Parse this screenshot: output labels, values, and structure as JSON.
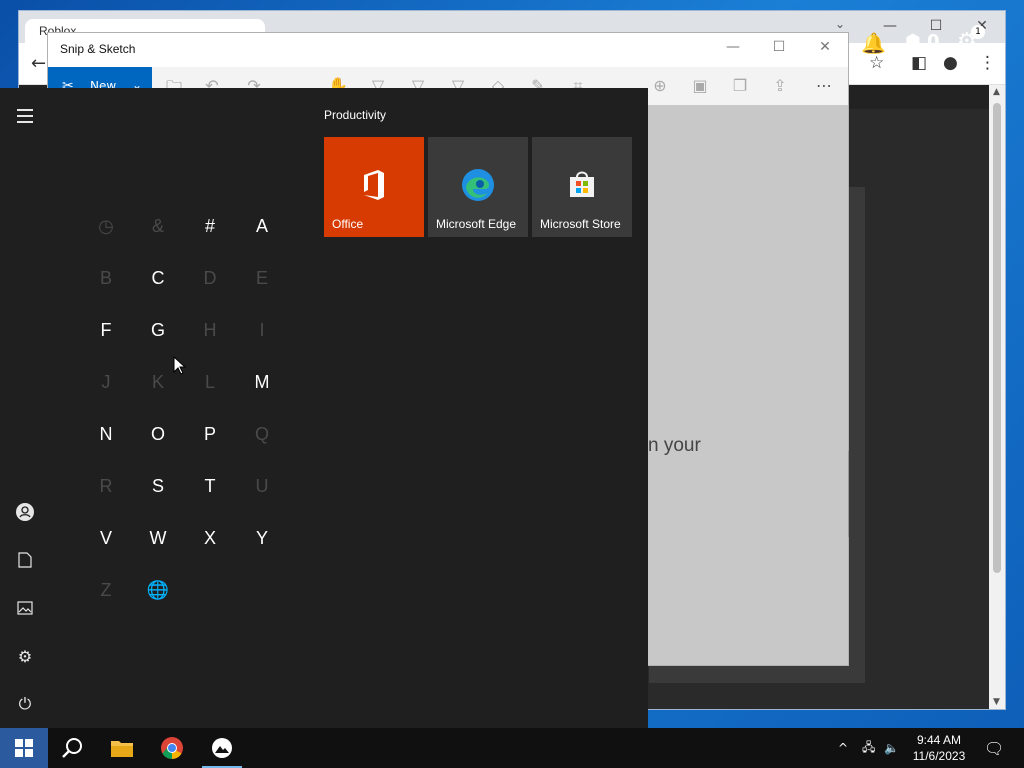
{
  "chrome": {
    "tab_title": "Roblox",
    "robux_count": "0",
    "settings_badge": "1"
  },
  "snip": {
    "title": "Snip & Sketch",
    "new_label": "New",
    "canvas_partial_text": "n your"
  },
  "start_menu": {
    "group_title": "Productivity",
    "tiles": [
      {
        "label": "Office",
        "color": "#d83b01"
      },
      {
        "label": "Microsoft Edge",
        "color": "#3a3a3a"
      },
      {
        "label": "Microsoft Store",
        "color": "#3a3a3a"
      }
    ],
    "letters": [
      {
        "char": "◷",
        "enabled": false
      },
      {
        "char": "&",
        "enabled": false
      },
      {
        "char": "#",
        "enabled": true
      },
      {
        "char": "A",
        "enabled": true
      },
      {
        "char": "B",
        "enabled": false
      },
      {
        "char": "C",
        "enabled": true
      },
      {
        "char": "D",
        "enabled": false
      },
      {
        "char": "E",
        "enabled": false
      },
      {
        "char": "F",
        "enabled": true
      },
      {
        "char": "G",
        "enabled": true
      },
      {
        "char": "H",
        "enabled": false
      },
      {
        "char": "I",
        "enabled": false
      },
      {
        "char": "J",
        "enabled": false
      },
      {
        "char": "K",
        "enabled": false
      },
      {
        "char": "L",
        "enabled": false
      },
      {
        "char": "M",
        "enabled": true
      },
      {
        "char": "N",
        "enabled": true
      },
      {
        "char": "O",
        "enabled": true
      },
      {
        "char": "P",
        "enabled": true
      },
      {
        "char": "Q",
        "enabled": false
      },
      {
        "char": "R",
        "enabled": false
      },
      {
        "char": "S",
        "enabled": true
      },
      {
        "char": "T",
        "enabled": true
      },
      {
        "char": "U",
        "enabled": false
      },
      {
        "char": "V",
        "enabled": true
      },
      {
        "char": "W",
        "enabled": true
      },
      {
        "char": "X",
        "enabled": true
      },
      {
        "char": "Y",
        "enabled": true
      },
      {
        "char": "Z",
        "enabled": false
      },
      {
        "char": "🌐",
        "enabled": false
      }
    ]
  },
  "taskbar": {
    "time": "9:44 AM",
    "date": "11/6/2023"
  },
  "colors": {
    "accent": "#0067c0",
    "office_tile": "#d83b01",
    "start_bg": "#1f1f1f"
  }
}
